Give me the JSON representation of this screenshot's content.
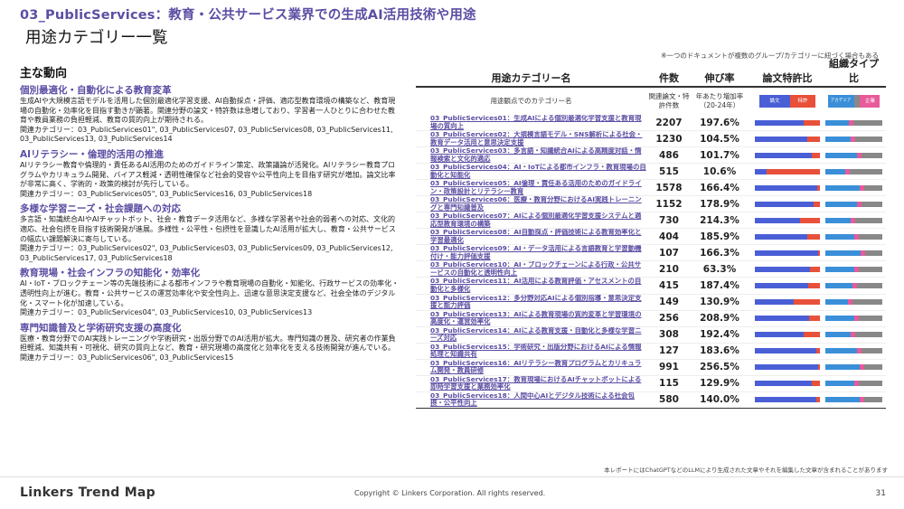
{
  "header": {
    "section_title": "03_PublicServices：教育・公共サービス業界での生成AI活用技術や用途",
    "subtitle": "用途カテゴリー一覧",
    "note": "※一つのドキュメントが複数のグループ/カテゴリーに紐づく場合もある"
  },
  "trends": {
    "heading": "主な動向",
    "items": [
      {
        "title": "個別最適化・自動化による教育変革",
        "body": "生成AIや大規模言語モデルを活用した個別最適化学習支援、AI自動採点・評価、適応型教育環境の構築など、教育現場の自動化・効率化を目指す動きが顕著。関連分野の論文・特許数は急増しており、学習者一人ひとりに合わせた教育や教員業務の負担軽減、教育の質的向上が期待される。",
        "related": "関連カテゴリー：03_PublicServices01\", 03_PublicServices07, 03_PublicServices08, 03_PublicServices11, 03_PublicServices13, 03_PublicServices14"
      },
      {
        "title": "AIリテラシー・倫理的活用の推進",
        "body": "AIリテラシー教育や倫理的・責任あるAI活用のためのガイドライン策定、政策議論が活発化。AIリテラシー教育プログラムやカリキュラム開発、バイアス軽減・透明性確保など社会的受容や公平性向上を目指す研究が増加。論文比率が非常に高く、学術的・政策的検討が先行している。",
        "related": "関連カテゴリー：03_PublicServices05\", 03_PublicServices16, 03_PublicServices18"
      },
      {
        "title": "多様な学習ニーズ・社会課題への対応",
        "body": "多言語・知識統合AIやAIチャットボット、社会・教育データ活用など、多様な学習者や社会的弱者への対応、文化的適応、社会包摂を目指す技術開発が進展。多様性・公平性・包摂性を意識したAI活用が拡大し、教育・公共サービスの幅広い課題解決に寄与している。",
        "related": "関連カテゴリー：03_PublicServices02\", 03_PublicServices03, 03_PublicServices09, 03_PublicServices12, 03_PublicServices17, 03_PublicServices18"
      },
      {
        "title": "教育現場・社会インフラの知能化・効率化",
        "body": "AI・IoT・ブロックチェーン等の先端技術による都市インフラや教育現場の自動化・知能化、行政サービスの効率化・透明性向上が進む。教育・公共サービスの運営効率化や安全性向上、迅速な意思決定支援など、社会全体のデジタル化・スマート化が加速している。",
        "related": "関連カテゴリー：03_PublicServices04\", 03_PublicServices10, 03_PublicServices13"
      },
      {
        "title": "専門知識普及と学術研究支援の高度化",
        "body": "医療・教育分野でのAI実践トレーニングや学術研究・出版分野でのAI活用が拡大。専門知識の普及、研究者の作業負担軽減、知識共有・可視化、研究の質向上など、教育・研究現場の高度化と効率化を支える技術開発が進んでいる。",
        "related": "関連カテゴリー：03_PublicServices06\", 03_PublicServices15"
      }
    ]
  },
  "table": {
    "headers": {
      "name": "用途カテゴリー名",
      "count": "件数",
      "growth": "伸び率",
      "ratio": "論文特許比",
      "type": "組織タイプ比"
    },
    "subheaders": {
      "name": "用途観点でのカテゴリー名",
      "count": "関連論文・特許件数",
      "growth": "年あたり増加率（20-24年）"
    },
    "legend_ratio": [
      "論文",
      "特許"
    ],
    "legend_type": [
      "アカデミア",
      "企業"
    ],
    "colors": {
      "paper": "#4a5fd6",
      "patent": "#e8503a",
      "academia": "#3a8fd8",
      "mid": "#888888",
      "company": "#e85a9a"
    },
    "rows": [
      {
        "name": "03_PublicServices01：生成AIによる個別最適化学習支援と教育現場の質向上",
        "count": "2207",
        "growth": "197.6%",
        "paper": 0.75,
        "acad": 0.42
      },
      {
        "name": "03_PublicServices02：大規模言語モデル・SNS解析による社会・教育データ活用と意思決定支援",
        "count": "1230",
        "growth": "104.5%",
        "paper": 0.8,
        "acad": 0.45
      },
      {
        "name": "03_PublicServices03：多言語・知識統合AIによる高精度対話・情報検索と文化的適応",
        "count": "486",
        "growth": "101.7%",
        "paper": 0.88,
        "acad": 0.55
      },
      {
        "name": "03_PublicServices04：AI・IoTによる都市インフラ・教育現場の自動化と知能化",
        "count": "515",
        "growth": "10.6%",
        "paper": 0.18,
        "acad": 0.35
      },
      {
        "name": "03_PublicServices05：AI倫理・責任ある活用のためのガイドライン・政策設計とリテラシー教育",
        "count": "1578",
        "growth": "166.4%",
        "paper": 0.96,
        "acad": 0.6
      },
      {
        "name": "03_PublicServices06：医療・教育分野におけるAI実践トレーニングと専門知識普及",
        "count": "1152",
        "growth": "178.9%",
        "paper": 0.9,
        "acad": 0.55
      },
      {
        "name": "03_PublicServices07：AIによる個別最適化学習支援システムと適応型教育環境の構築",
        "count": "730",
        "growth": "214.3%",
        "paper": 0.7,
        "acad": 0.45
      },
      {
        "name": "03_PublicServices08：AI自動採点・評価技術による教育効率化と学習最適化",
        "count": "404",
        "growth": "185.9%",
        "paper": 0.8,
        "acad": 0.5
      },
      {
        "name": "03_PublicServices09：AI・データ活用による言語教育と学習動機付け・能力評価支援",
        "count": "107",
        "growth": "166.3%",
        "paper": 0.97,
        "acad": 0.62
      },
      {
        "name": "03_PublicServices10：AI・ブロックチェーンによる行政・公共サービスの自動化と透明性向上",
        "count": "210",
        "growth": "63.3%",
        "paper": 0.85,
        "acad": 0.5
      },
      {
        "name": "03_PublicServices11：AI活用による教育評価・アセスメントの自動化と多様化",
        "count": "415",
        "growth": "187.4%",
        "paper": 0.82,
        "acad": 0.48
      },
      {
        "name": "03_PublicServices12：多分野対応AIによる個別指導・意思決定支援と能力評価",
        "count": "149",
        "growth": "130.9%",
        "paper": 0.6,
        "acad": 0.4
      },
      {
        "name": "03_PublicServices13：AIによる教育現場の質的変革と学習環境の高度化・運営効率化",
        "count": "256",
        "growth": "208.9%",
        "paper": 0.83,
        "acad": 0.5
      },
      {
        "name": "03_PublicServices14：AIによる教育支援・自動化と多様な学習ニーズ対応",
        "count": "308",
        "growth": "192.4%",
        "paper": 0.75,
        "acad": 0.45
      },
      {
        "name": "03_PublicServices15：学術研究・出版分野におけるAIによる情報処理と知識共有",
        "count": "127",
        "growth": "183.6%",
        "paper": 0.95,
        "acad": 0.55
      },
      {
        "name": "03_PublicServices16：AIリテラシー教育プログラムとカリキュラム開発・教員研修",
        "count": "991",
        "growth": "256.5%",
        "paper": 0.97,
        "acad": 0.6
      },
      {
        "name": "03_PublicServices17：教育現場におけるAIチャットボットによる即時学習支援と業務効率化",
        "count": "115",
        "growth": "129.9%",
        "paper": 0.88,
        "acad": 0.5
      },
      {
        "name": "03_PublicServices18：人間中心AIとデジタル技術による社会包摂・公平性向上",
        "count": "580",
        "growth": "140.0%",
        "paper": 0.95,
        "acad": 0.6
      }
    ]
  },
  "footer": {
    "note": "本レポートにはChatGPTなどのLLMにより生成された文章やそれを編集した文章が含まれることがあります",
    "brand": "Linkers Trend Map",
    "copyright": "Copyright © Linkers Corporation. All rights reserved.",
    "page": "31"
  }
}
